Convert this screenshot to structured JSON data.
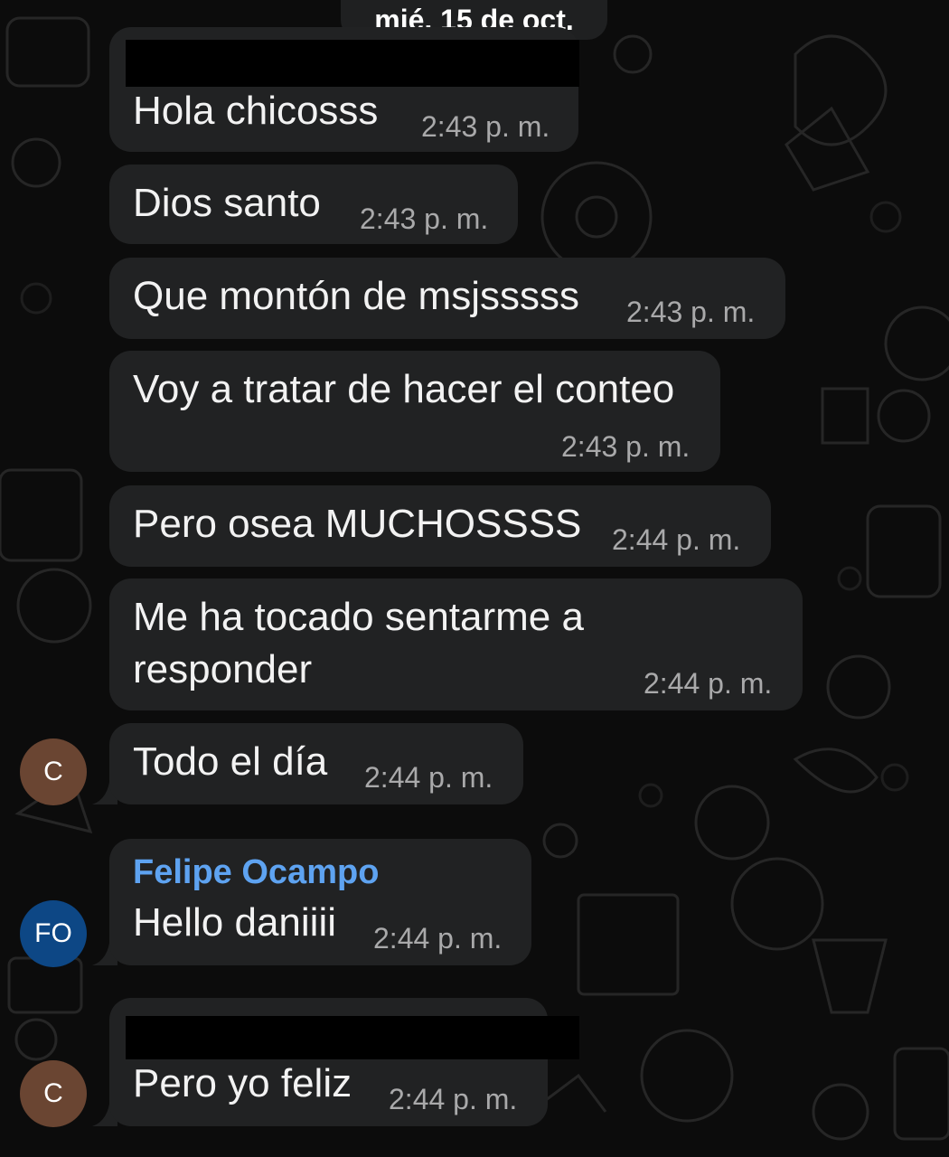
{
  "header": {
    "date": "mié, 15 de oct."
  },
  "messages": [
    {
      "text": "Hola chicosss",
      "time": "2:43 p. m."
    },
    {
      "text": "Dios santo",
      "time": "2:43 p. m."
    },
    {
      "text": "Que montón de msjsssss",
      "time": "2:43 p. m."
    },
    {
      "text": "Voy a tratar de hacer el conteo",
      "time": "2:43 p. m."
    },
    {
      "text": "Pero osea MUCHOSSSS",
      "time": "2:44 p. m."
    },
    {
      "text_line1": "Me ha tocado sentarme a",
      "text_line2": "responder",
      "time": "2:44 p. m."
    },
    {
      "text": "Todo el día",
      "time": "2:44 p. m.",
      "avatar": "C"
    },
    {
      "sender": "Felipe Ocampo",
      "text": "Hello daniiii",
      "time": "2:44 p. m.",
      "avatar": "FO"
    },
    {
      "text": "Pero yo feliz",
      "time": "2:44 p. m.",
      "avatar": "C"
    }
  ],
  "colors": {
    "background": "#0c0c0c",
    "bubble": "#212223",
    "sender_name": "#5ea3f1",
    "avatar_c": "#6a4532",
    "avatar_fo": "#0d4785"
  }
}
